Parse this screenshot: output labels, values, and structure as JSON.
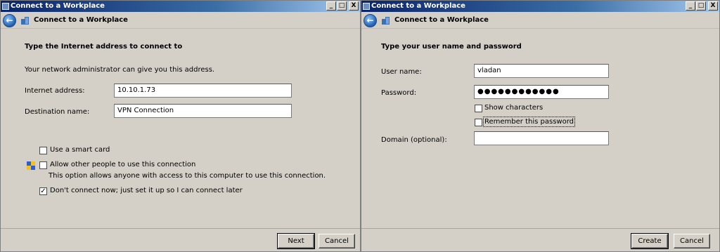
{
  "window_left": {
    "title": "Connect to a Workplace",
    "nav_title": "Connect to a Workplace",
    "heading": "Type the Internet address to connect to",
    "intro": "Your network administrator can give you this address.",
    "internet_address_label": "Internet address:",
    "internet_address_value": "10.10.1.73",
    "destination_name_label": "Destination name:",
    "destination_name_value": "VPN Connection",
    "smart_card_label": "Use a smart card",
    "smart_card_checked": false,
    "allow_others_label": "Allow other people to use this connection",
    "allow_others_note": "This option allows anyone with access to this computer to use this connection.",
    "allow_others_checked": false,
    "dont_connect_label": "Don't connect now; just set it up so I can connect later",
    "dont_connect_checked": true,
    "next_label": "Next",
    "cancel_label": "Cancel"
  },
  "window_right": {
    "title": "Connect to a Workplace",
    "nav_title": "Connect to a Workplace",
    "heading": "Type your user name and password",
    "username_label": "User name:",
    "username_value": "vladan",
    "password_label": "Password:",
    "password_value": "●●●●●●●●●●●●",
    "show_chars_label": "Show characters",
    "show_chars_checked": false,
    "remember_label": "Remember this password",
    "remember_checked": false,
    "domain_label": "Domain (optional):",
    "domain_value": "",
    "create_label": "Create",
    "cancel_label": "Cancel"
  },
  "titlebar_buttons": {
    "minimize": "_",
    "maximize": "□",
    "close": "X"
  },
  "check_mark": "✓"
}
